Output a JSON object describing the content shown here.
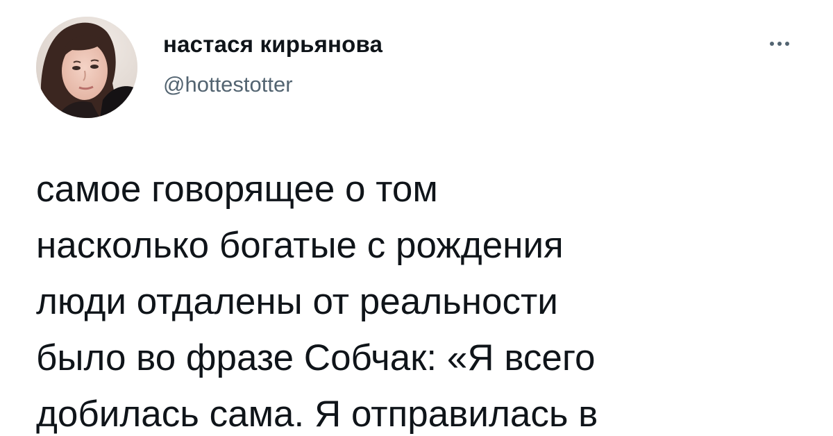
{
  "author": {
    "display_name": "настася кирьянова",
    "handle": "@hottestotter"
  },
  "menu": {
    "icon": "more-horizontal-icon"
  },
  "tweet": {
    "lines": [
      "самое говорящее о том",
      "насколько богатые с рождения",
      "люди отдалены от реальности",
      "было во фразе Собчак: «Я всего",
      "добилась сама. Я отправилась в"
    ]
  }
}
